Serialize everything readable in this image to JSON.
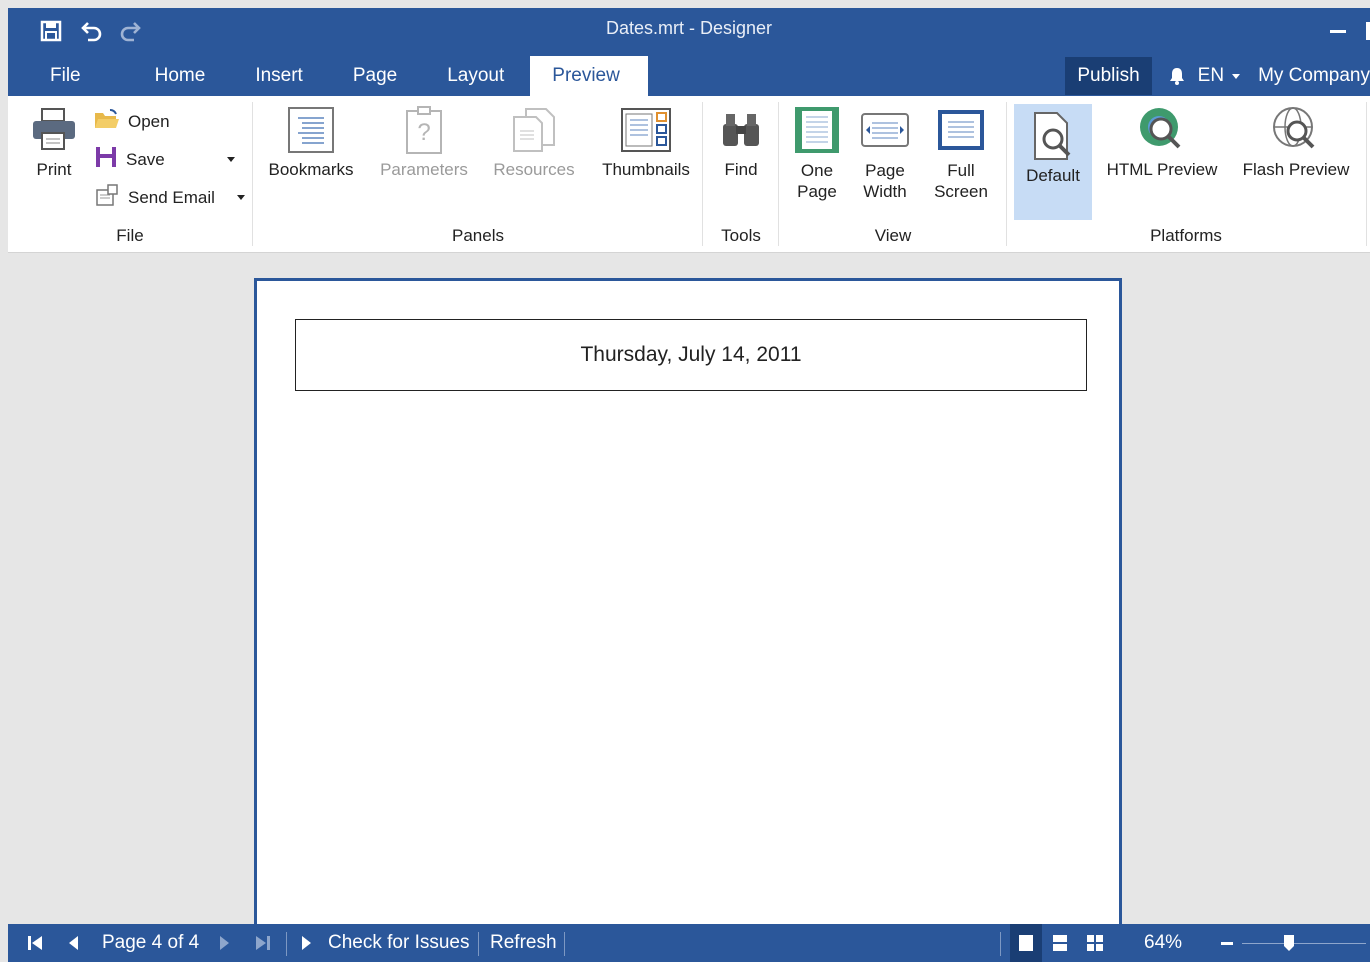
{
  "window": {
    "title": "Dates.mrt - Designer"
  },
  "quick_access": {
    "icons": [
      "save-icon",
      "undo-icon",
      "redo-icon"
    ]
  },
  "tabs": [
    {
      "label": "File"
    },
    {
      "label": "Home"
    },
    {
      "label": "Insert"
    },
    {
      "label": "Page"
    },
    {
      "label": "Layout"
    },
    {
      "label": "Preview",
      "active": true
    }
  ],
  "header_right": {
    "publish": "Publish",
    "language": "EN",
    "company": "My Company"
  },
  "ribbon": {
    "file": {
      "label": "File",
      "print": "Print",
      "open": "Open",
      "save": "Save",
      "send_email": "Send Email"
    },
    "panels": {
      "label": "Panels",
      "bookmarks": "Bookmarks",
      "parameters": "Parameters",
      "resources": "Resources",
      "thumbnails": "Thumbnails"
    },
    "tools": {
      "label": "Tools",
      "find": "Find"
    },
    "view": {
      "label": "View",
      "one_page_1": "One",
      "one_page_2": "Page",
      "page_width_1": "Page",
      "page_width_2": "Width",
      "full_screen_1": "Full",
      "full_screen_2": "Screen"
    },
    "platforms": {
      "label": "Platforms",
      "default": "Default",
      "html_preview": "HTML Preview",
      "flash_preview": "Flash Preview"
    }
  },
  "report": {
    "date_text": "Thursday, July 14, 2011"
  },
  "statusbar": {
    "page_info": "Page 4 of 4",
    "check_issues": "Check for Issues",
    "refresh": "Refresh",
    "zoom": "64%"
  },
  "colors": {
    "accent": "#2b579a",
    "selected": "#c7dcf5"
  }
}
